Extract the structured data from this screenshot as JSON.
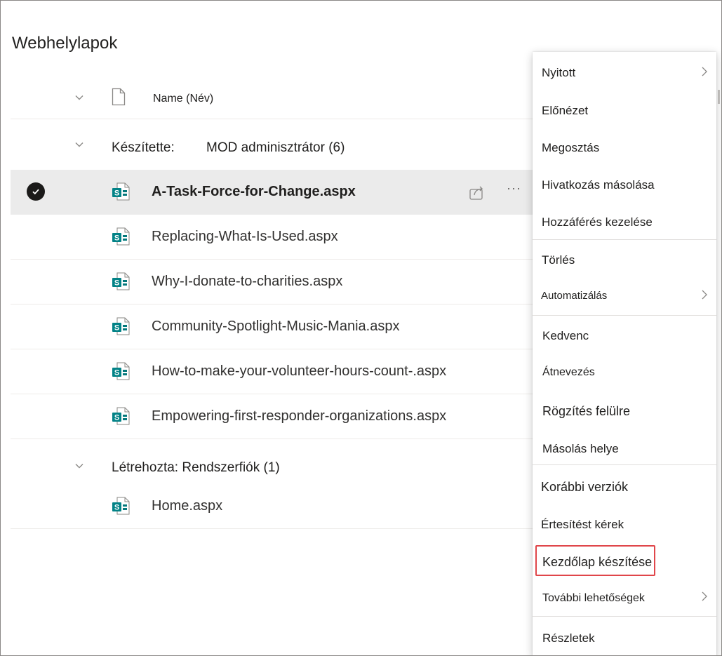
{
  "page": {
    "title": "Webhelylapok"
  },
  "list": {
    "column_name": "Name (Név)",
    "groups": [
      {
        "label": "Készítette:",
        "value": "MOD adminisztrátor (6)",
        "files": [
          "A-Task-Force-for-Change.aspx",
          "Replacing-What-Is-Used.aspx",
          "Why-I-donate-to-charities.aspx",
          "Community-Spotlight-Music-Mania.aspx",
          "How-to-make-your-volunteer-hours-count-.aspx",
          "Empowering-first-responder-organizations.aspx"
        ]
      },
      {
        "label": "Létrehozta: Rendszerfiók (1)",
        "files": [
          "Home.aspx"
        ]
      }
    ]
  },
  "context_menu": {
    "items": [
      "Nyitott",
      "Előnézet",
      "Megosztás",
      "Hivatkozás másolása",
      "Hozzáférés kezelése",
      "Törlés",
      "Automatizálás",
      "Kedvenc",
      "Átnevezés",
      "Rögzítés felülre",
      "Másolás helye",
      "Korábbi verziók",
      "Értesítést kérek",
      "Kezdőlap készítése",
      "További lehetőségek",
      "Részletek"
    ],
    "highlighted": "Kezdőlap készítése"
  },
  "colors": {
    "sharepoint_teal": "#038387",
    "highlight_border": "#e0464a",
    "selected_row": "#ebebeb"
  }
}
